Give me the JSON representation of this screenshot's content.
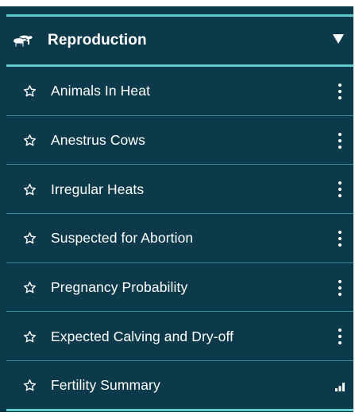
{
  "menu": {
    "section_title": "Reproduction",
    "section_icon": "herd-icon",
    "items": [
      {
        "label": "Animals In Heat",
        "action_icon": "kebab-menu-icon"
      },
      {
        "label": "Anestrus Cows",
        "action_icon": "kebab-menu-icon"
      },
      {
        "label": "Irregular Heats",
        "action_icon": "kebab-menu-icon"
      },
      {
        "label": "Suspected for Abortion",
        "action_icon": "kebab-menu-icon"
      },
      {
        "label": "Pregnancy Probability",
        "action_icon": "kebab-menu-icon"
      },
      {
        "label": "Expected Calving and Dry-off",
        "action_icon": "kebab-menu-icon"
      },
      {
        "label": "Fertility Summary",
        "action_icon": "bar-chart-icon"
      }
    ]
  },
  "colors": {
    "background": "#0d3a4a",
    "accent_rule": "#5fc9cb",
    "item_rule": "#3a8f96",
    "text": "#ffffff"
  }
}
